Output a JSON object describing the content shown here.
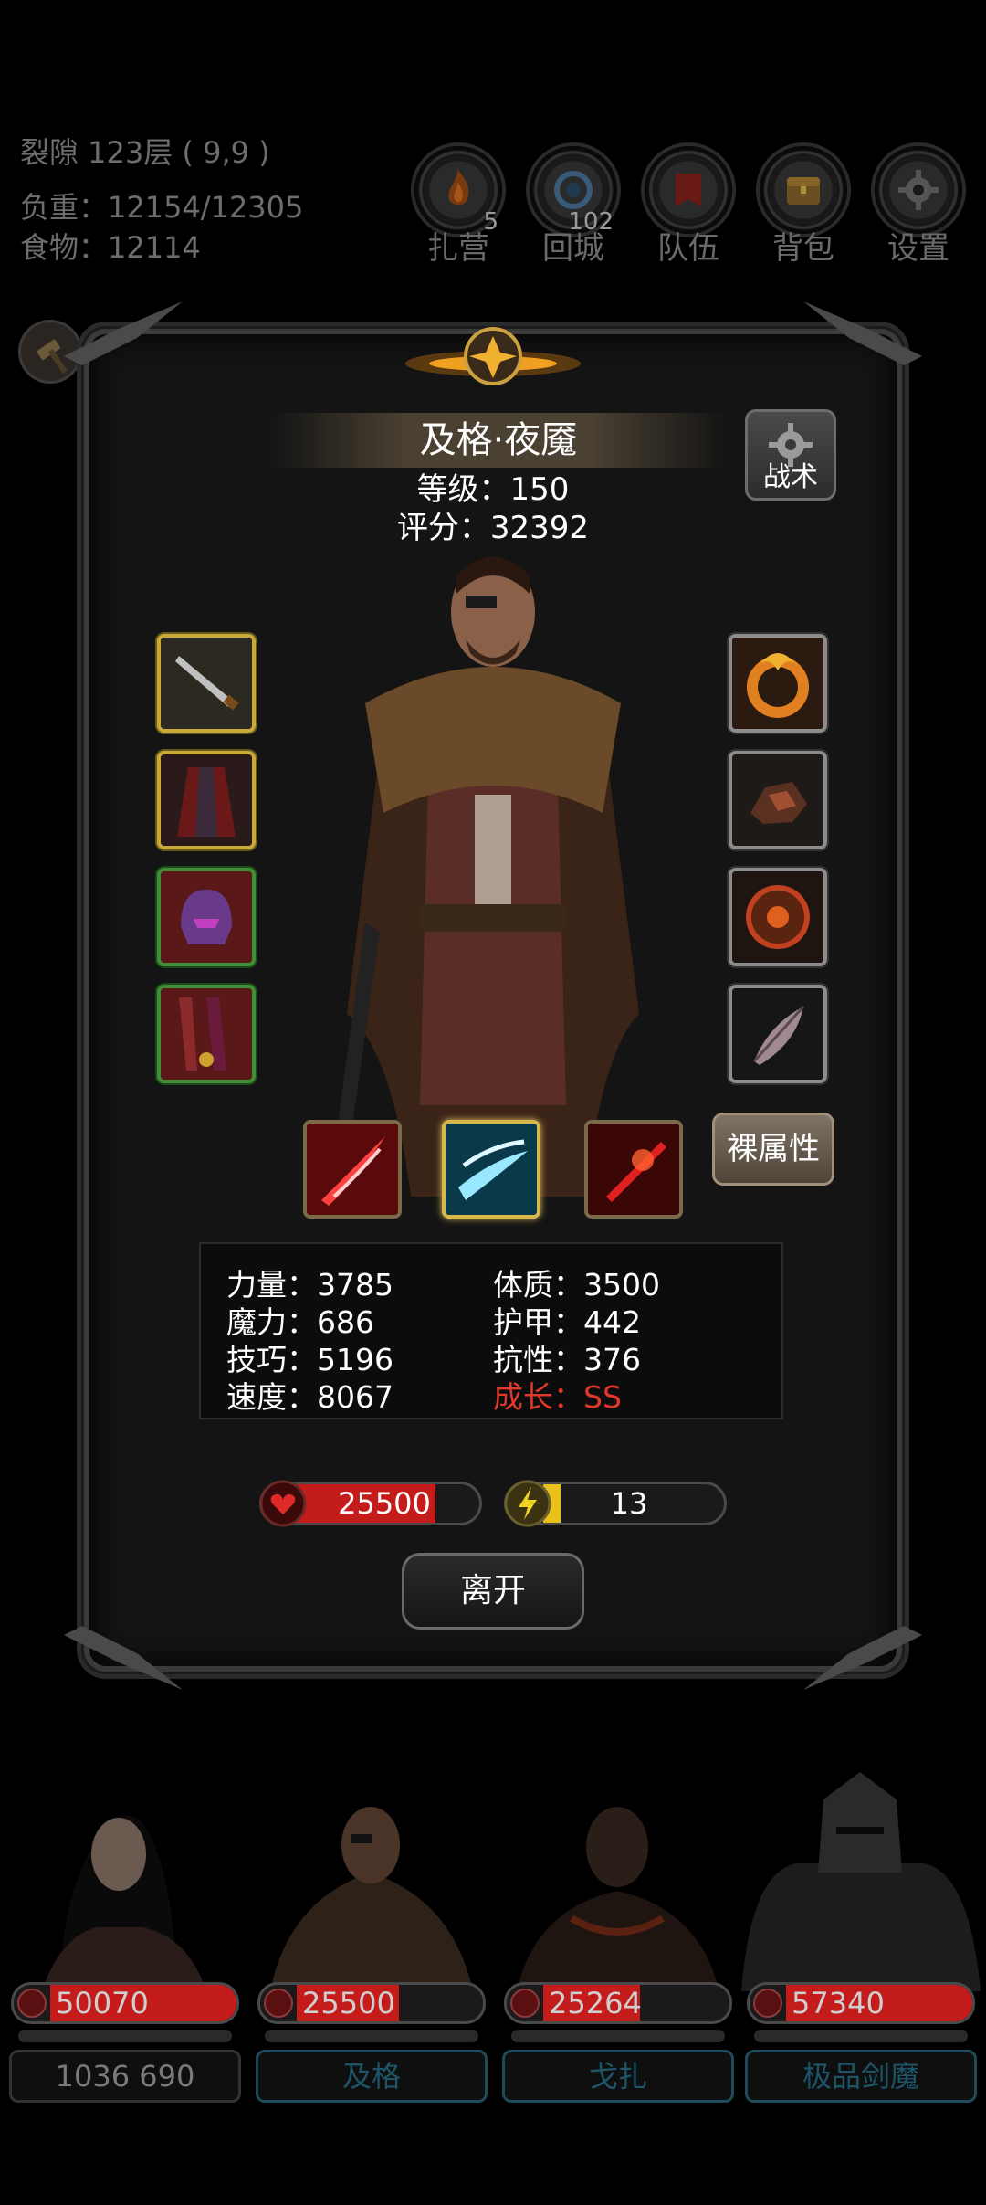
{
  "hud": {
    "location": "裂隙 123层 ( 9,9 )",
    "weight": "负重：12154/12305",
    "food": "食物：12114"
  },
  "menu": [
    {
      "label": "扎营",
      "count": "5",
      "icon": "campfire-icon"
    },
    {
      "label": "回城",
      "count": "102",
      "icon": "portal-icon"
    },
    {
      "label": "队伍",
      "count": "",
      "icon": "banner-icon"
    },
    {
      "label": "背包",
      "count": "",
      "icon": "chest-icon"
    },
    {
      "label": "设置",
      "count": "",
      "icon": "gear-icon"
    }
  ],
  "character": {
    "name": "及格·夜魇",
    "level": "等级：150",
    "score": "评分：32392",
    "tactics_label": "战术",
    "bare_attr_label": "裸属性",
    "attributes": {
      "strength": "力量：3785",
      "constitution": "体质：3500",
      "magic": "魔力：686",
      "armor": "护甲：442",
      "skill": "技巧：5196",
      "resistance": "抗性：376",
      "speed": "速度：8067",
      "growth": "成长：SS"
    },
    "hp": {
      "value": "25500",
      "fill": 0.8
    },
    "energy": {
      "value": "13",
      "fill": 0.08
    },
    "leave_label": "离开"
  },
  "colors": {
    "hp_red": "#c41b1b",
    "energy_yellow": "#e8c21a",
    "growth_red": "#e0382a",
    "gold_frame": "#c8a93a",
    "green_frame": "#3f8f3a"
  },
  "party": [
    {
      "hp": "50070",
      "hp_fill": 1.0,
      "name": "1036 690"
    },
    {
      "hp": "25500",
      "hp_fill": 0.55,
      "name": "及格"
    },
    {
      "hp": "25264",
      "hp_fill": 0.52,
      "name": "戈扎"
    },
    {
      "hp": "57340",
      "hp_fill": 1.0,
      "name": "极品剑魔"
    }
  ]
}
